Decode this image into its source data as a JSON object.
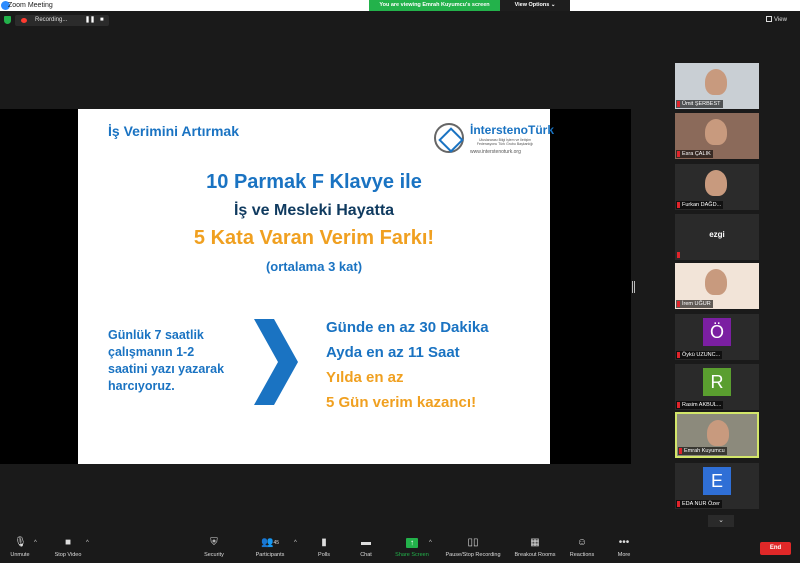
{
  "window": {
    "title": "Zoom Meeting"
  },
  "banner": {
    "text": "You are viewing Emrah Kuyumcu's screen",
    "view_options": "View Options ⌄"
  },
  "recording": {
    "label": "Recording...",
    "pause": "❚❚",
    "stop": "■"
  },
  "view": {
    "label": "View"
  },
  "slide": {
    "heading": "İş Verimini Artırmak",
    "logo_name": "İnterstenoTürk",
    "logo_sub": "Uluslararası Bilgi İşlem ve İletişim Federasyonu Türk Grubu Başkanlığı",
    "logo_url": "www.interstenoturk.org",
    "line1": "10 Parmak F Klavye ile",
    "line2": "İş ve Mesleki Hayatta",
    "line3": "5 Kata Varan Verim Farkı!",
    "line4": "(ortalama 3 kat)",
    "left_lines": [
      "Günlük 7 saatlik",
      "çalışmanın 1-2",
      "saatini yazı yazarak",
      "harcıyoruz."
    ],
    "right_lines": [
      {
        "text": "Günde en az 30 Dakika",
        "color": "blue"
      },
      {
        "text": "Ayda en az 11 Saat",
        "color": "blue"
      },
      {
        "text": "Yılda en az",
        "color": "orange"
      },
      {
        "text": "5 Gün verim kazancı!",
        "color": "orange"
      }
    ]
  },
  "participants": [
    {
      "name": "Ümit ŞERBEST",
      "type": "photo",
      "bg": "#c9cfd4"
    },
    {
      "name": "Esra ÇALIK",
      "type": "photo",
      "bg": "#8b6a5a"
    },
    {
      "name": "Furkan DAĞD...",
      "type": "photo",
      "bg": "#2b2b2b"
    },
    {
      "name": "ezgi",
      "type": "text"
    },
    {
      "name": "İrem UĞUR",
      "type": "photo",
      "bg": "#f2e4d8"
    },
    {
      "name": "Öykü UZUNC...",
      "type": "initial",
      "initial": "Ö",
      "color": "#7b1fa2"
    },
    {
      "name": "Rasim AKBUL...",
      "type": "initial",
      "initial": "R",
      "color": "#5a9e2f"
    },
    {
      "name": "Emrah Kuyumcu",
      "type": "photo",
      "bg": "#8c8a7c",
      "active": true
    },
    {
      "name": "EDA NUR Özer",
      "type": "initial",
      "initial": "E",
      "color": "#2f6fd6"
    }
  ],
  "toolbar": {
    "unmute": "Unmute",
    "stop_video": "Stop Video",
    "security": "Security",
    "participants": "Participants",
    "participants_count": "45",
    "polls": "Polls",
    "chat": "Chat",
    "share_screen": "Share Screen",
    "pause_recording": "Pause/Stop Recording",
    "breakout": "Breakout Rooms",
    "reactions": "Reactions",
    "more": "More",
    "end": "End"
  }
}
